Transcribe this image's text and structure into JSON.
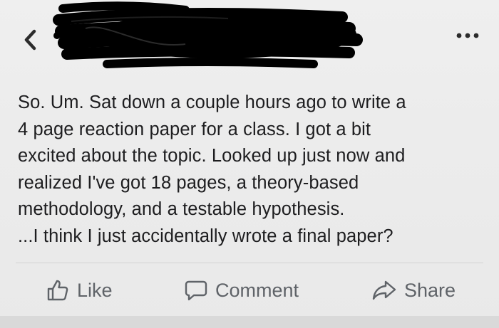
{
  "header": {
    "back_icon": "chevron-left-icon",
    "more_icon": "ellipsis-icon"
  },
  "post": {
    "lines": [
      "So. Um. Sat down a couple hours ago to write a",
      "4 page reaction paper for a class. I got a bit",
      "excited about the topic. Looked up just now and",
      "realized I've got 18 pages, a theory-based",
      "methodology, and a testable hypothesis.",
      "...I think I just accidentally wrote a final paper?"
    ]
  },
  "actions": {
    "like_label": "Like",
    "comment_label": "Comment",
    "share_label": "Share"
  },
  "colors": {
    "background": "#ececec",
    "text": "#1d1d1f",
    "action_text": "#5f6368",
    "redaction": "#000000"
  }
}
